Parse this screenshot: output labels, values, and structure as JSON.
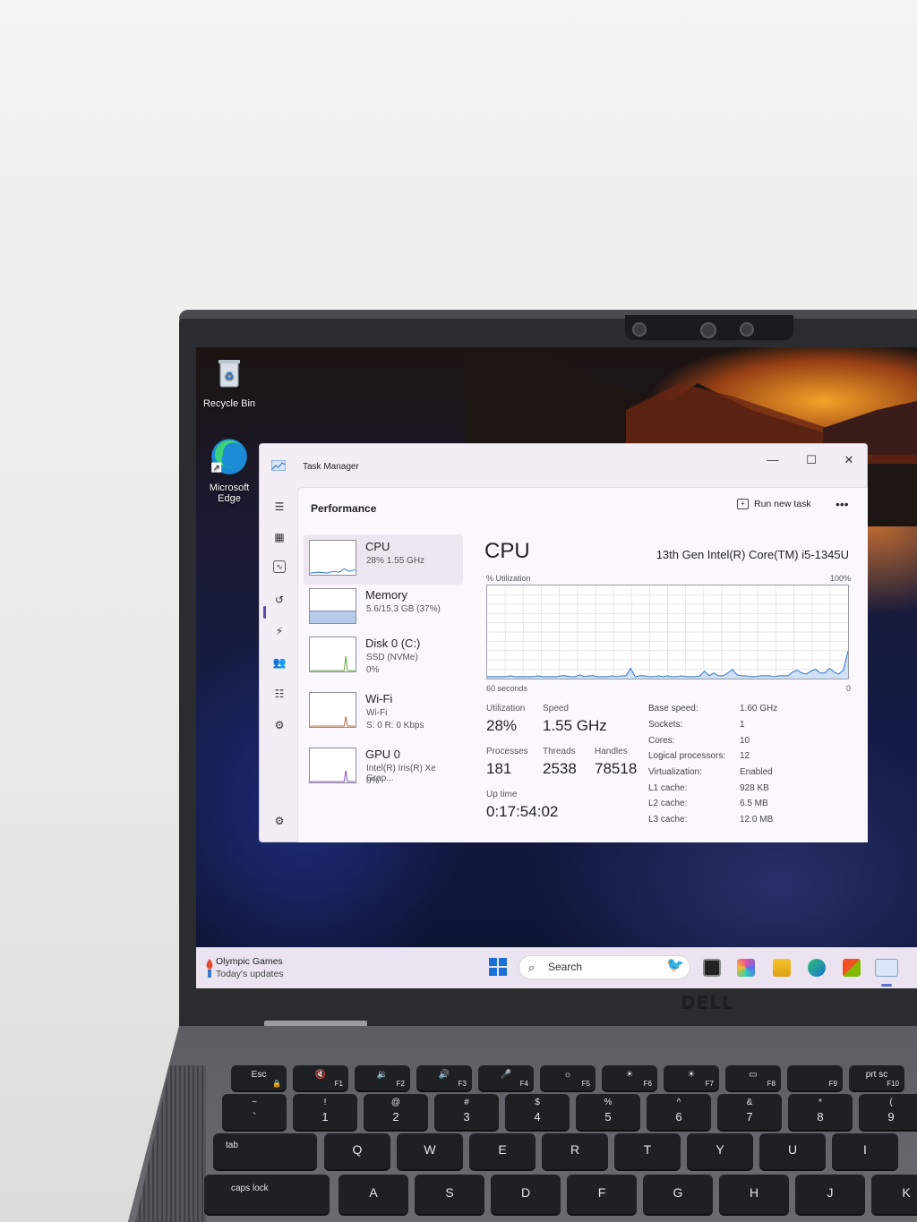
{
  "desktop": {
    "recycle_bin": "Recycle Bin",
    "edge_line1": "Microsoft",
    "edge_line2": "Edge"
  },
  "task_manager": {
    "title": "Task Manager",
    "window_controls": {
      "minimize": "—",
      "maximize": "☐",
      "close": "✕"
    },
    "header": "Performance",
    "run_new_task": "Run new task",
    "more": "•••",
    "resources": [
      {
        "name": "CPU",
        "sub1": "28%  1.55 GHz",
        "sub2": ""
      },
      {
        "name": "Memory",
        "sub1": "5.6/15.3 GB (37%)",
        "sub2": ""
      },
      {
        "name": "Disk 0 (C:)",
        "sub1": "SSD (NVMe)",
        "sub2": "0%"
      },
      {
        "name": "Wi-Fi",
        "sub1": "Wi-Fi",
        "sub2": "S: 0  R: 0 Kbps"
      },
      {
        "name": "GPU 0",
        "sub1": "Intel(R) Iris(R) Xe Grap...",
        "sub2": "0%"
      }
    ],
    "detail": {
      "title": "CPU",
      "model": "13th Gen Intel(R) Core(TM) i5-1345U",
      "util_label": "% Utilization",
      "max_label": "100%",
      "time_label": "60 seconds",
      "zero_label": "0",
      "utilization_series": [
        0.02,
        0.02,
        0.02,
        0.02,
        0.02,
        0.03,
        0.02,
        0.02,
        0.02,
        0.02,
        0.02,
        0.03,
        0.02,
        0.02,
        0.02,
        0.02,
        0.03,
        0.03,
        0.02,
        0.02,
        0.04,
        0.02,
        0.03,
        0.03,
        0.02,
        0.02,
        0.02,
        0.03,
        0.02,
        0.03,
        0.03,
        0.11,
        0.02,
        0.03,
        0.03,
        0.02,
        0.02,
        0.03,
        0.02,
        0.03,
        0.02,
        0.02,
        0.03,
        0.02,
        0.02,
        0.02,
        0.03,
        0.08,
        0.03,
        0.06,
        0.03,
        0.03,
        0.06,
        0.1,
        0.04,
        0.03,
        0.03,
        0.02,
        0.02,
        0.03,
        0.03,
        0.03,
        0.02,
        0.03,
        0.03,
        0.03,
        0.07,
        0.09,
        0.06,
        0.05,
        0.08,
        0.1,
        0.06,
        0.06,
        0.11,
        0.07,
        0.05,
        0.09,
        0.3
      ],
      "stats": {
        "utilization_label": "Utilization",
        "utilization": "28%",
        "speed_label": "Speed",
        "speed": "1.55 GHz",
        "processes_label": "Processes",
        "processes": "181",
        "threads_label": "Threads",
        "threads": "2538",
        "handles_label": "Handles",
        "handles": "78518",
        "uptime_label": "Up time",
        "uptime": "0:17:54:02"
      },
      "specs": [
        {
          "k": "Base speed:",
          "v": "1.60 GHz"
        },
        {
          "k": "Sockets:",
          "v": "1"
        },
        {
          "k": "Cores:",
          "v": "10"
        },
        {
          "k": "Logical processors:",
          "v": "12"
        },
        {
          "k": "Virtualization:",
          "v": "Enabled"
        },
        {
          "k": "L1 cache:",
          "v": "928 KB"
        },
        {
          "k": "L2 cache:",
          "v": "6.5 MB"
        },
        {
          "k": "L3 cache:",
          "v": "12.0 MB"
        }
      ]
    }
  },
  "taskbar": {
    "news_title": "Olympic Games",
    "news_sub": "Today's updates",
    "search_placeholder": "Search"
  },
  "laptop": {
    "brand": "DELL",
    "keys_row1": [
      {
        "main": "Esc",
        "sub": "🔒"
      },
      {
        "main": "🔇",
        "sub": "F1"
      },
      {
        "main": "🔉",
        "sub": "F2"
      },
      {
        "main": "🔊",
        "sub": "F3"
      },
      {
        "main": "🎤",
        "sub": "F4"
      },
      {
        "main": "☼",
        "sub": "F5"
      },
      {
        "main": "☀",
        "sub": "F6"
      },
      {
        "main": "☀",
        "sub": "F7"
      },
      {
        "main": "▭",
        "sub": "F8"
      },
      {
        "main": "",
        "sub": "F9"
      },
      {
        "main": "prt sc",
        "sub": "F10"
      }
    ],
    "keys_row2": [
      {
        "top": "~",
        "main": "`"
      },
      {
        "top": "!",
        "main": "1"
      },
      {
        "top": "@",
        "main": "2"
      },
      {
        "top": "#",
        "main": "3"
      },
      {
        "top": "$",
        "main": "4"
      },
      {
        "top": "%",
        "main": "5"
      },
      {
        "top": "^",
        "main": "6"
      },
      {
        "top": "&",
        "main": "7"
      },
      {
        "top": "*",
        "main": "8"
      },
      {
        "top": "(",
        "main": "9"
      }
    ],
    "keys_row3": [
      "tab",
      "Q",
      "W",
      "E",
      "R",
      "T",
      "Y",
      "U",
      "I"
    ],
    "keys_row4": [
      "caps lock",
      "A",
      "S",
      "D",
      "F",
      "G",
      "H",
      "J",
      "K"
    ]
  }
}
